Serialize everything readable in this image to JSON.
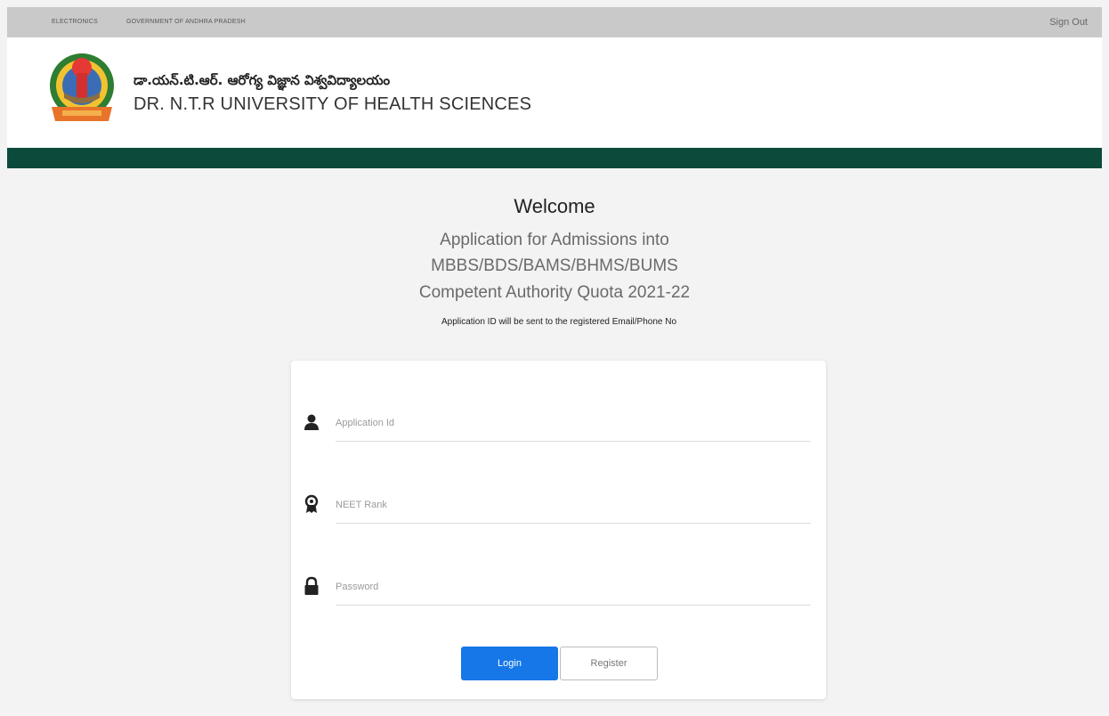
{
  "topbar": {
    "link1": "ELECTRONICS",
    "link2": "GOVERNMENT OF ANDHRA PRADESH",
    "signout": "Sign Out"
  },
  "header": {
    "title_telugu": "డా.యన్.టి.ఆర్. ఆరోగ్య విజ్ఞాన విశ్వవిద్యాలయం",
    "title_english": "DR. N.T.R UNIVERSITY OF HEALTH SCIENCES"
  },
  "main": {
    "welcome": "Welcome",
    "subtitle_line1": "Application for Admissions into",
    "subtitle_line2": "MBBS/BDS/BAMS/BHMS/BUMS",
    "subtitle_line3": "Competent Authority Quota 2021-22",
    "note": "Application ID will be sent to the registered Email/Phone No"
  },
  "form": {
    "application_id_placeholder": "Application Id",
    "neet_rank_placeholder": "NEET Rank",
    "password_placeholder": "Password",
    "login_label": "Login",
    "register_label": "Register"
  },
  "colors": {
    "topbar": "#c9c9c9",
    "green_band": "#0c4a3c",
    "login_button": "#1677e8",
    "background": "#f3f3f3"
  },
  "icons": {
    "logo": "university-emblem",
    "field1": "user-icon",
    "field2": "award-icon",
    "field3": "lock-icon"
  }
}
